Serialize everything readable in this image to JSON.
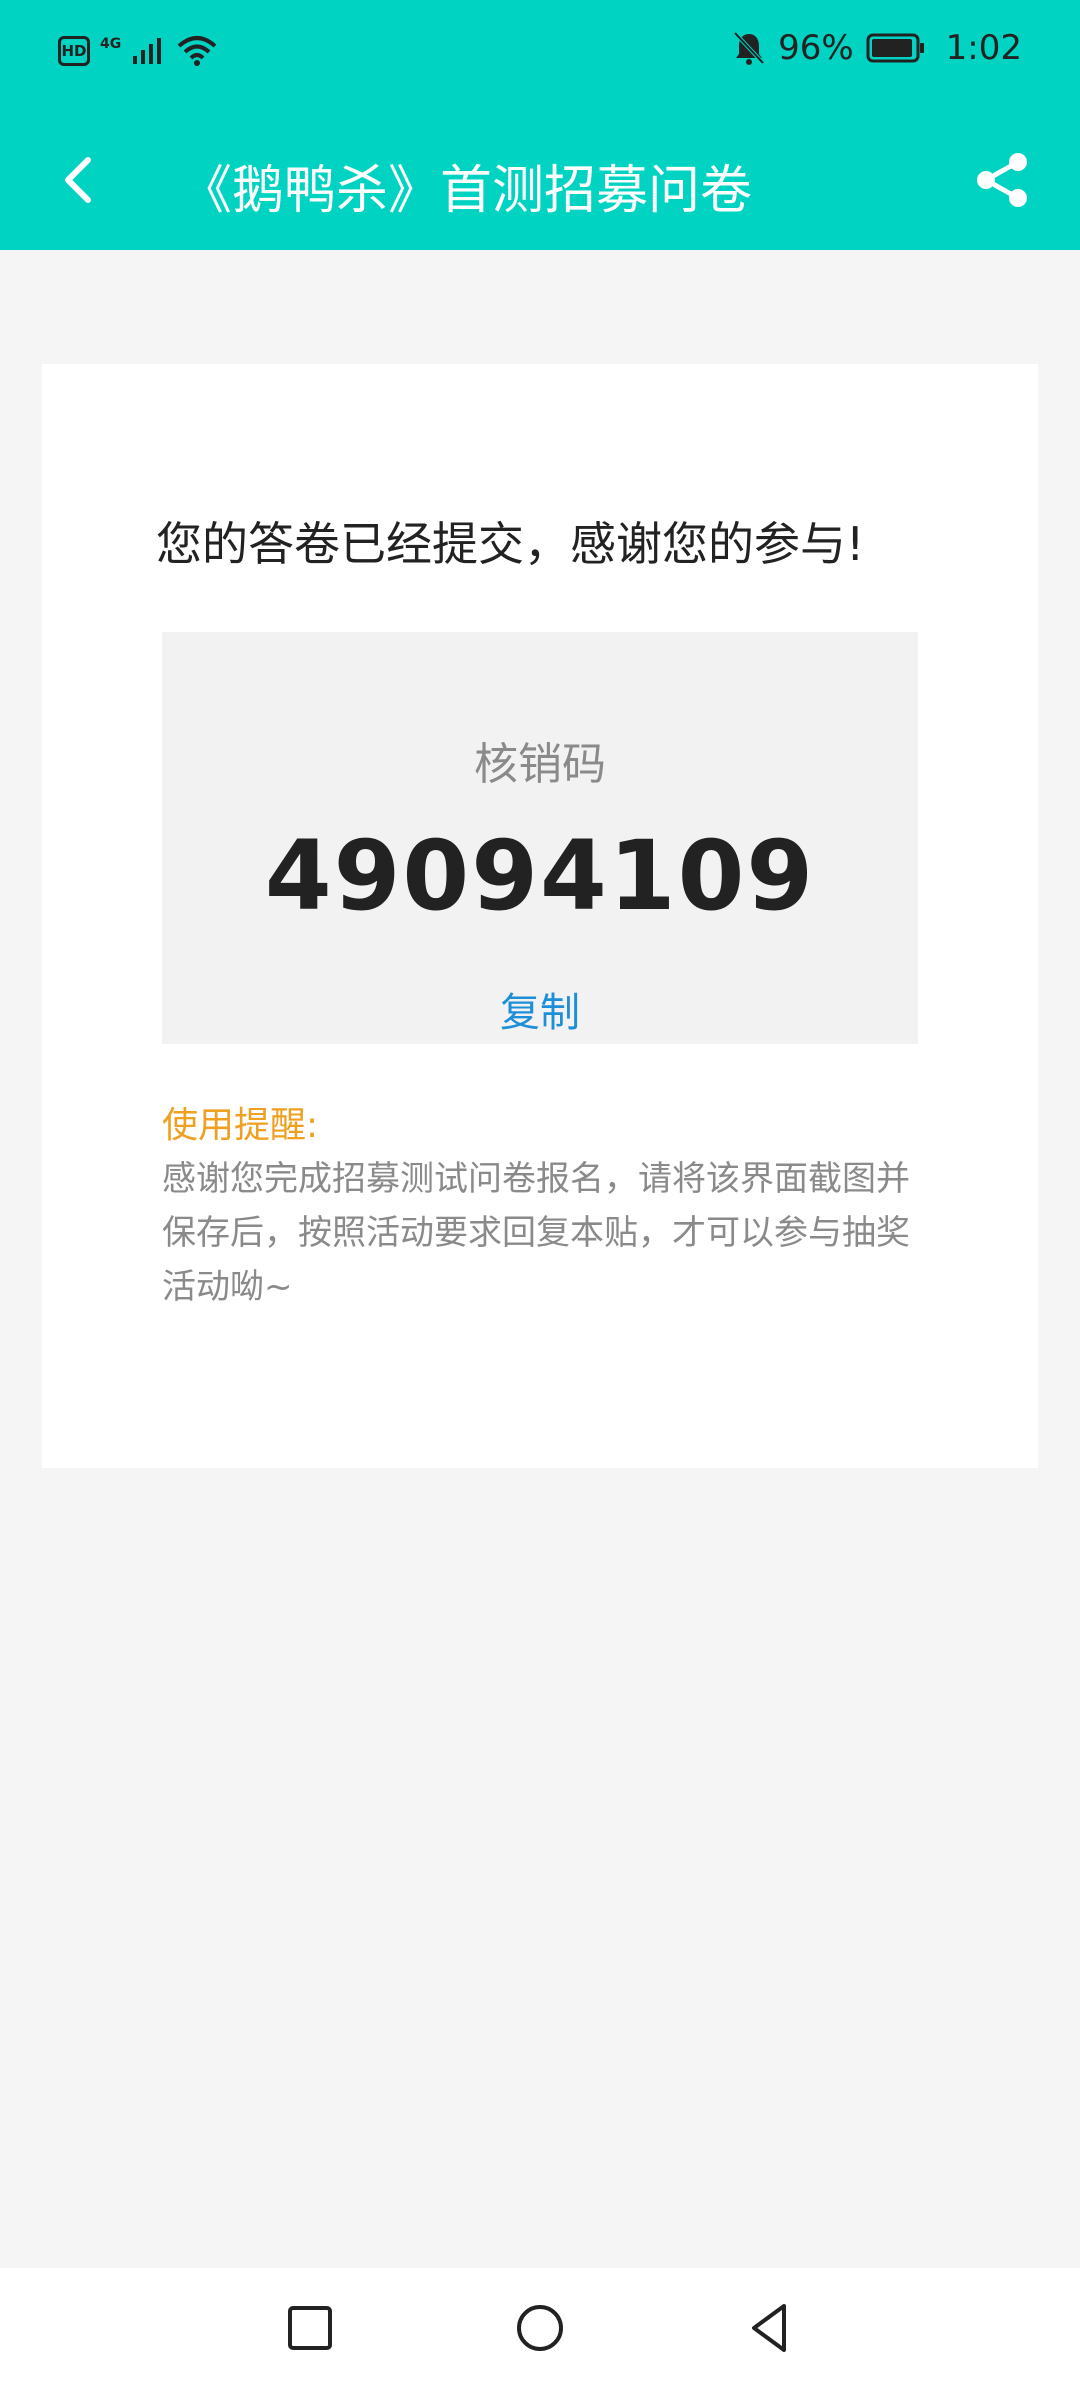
{
  "status_bar": {
    "hd_label": "HD",
    "network_label": "4G",
    "battery_percent": "96%",
    "time": "1:02",
    "battery_level": 0.96
  },
  "app_bar": {
    "title": "《鹅鸭杀》首测招募问卷",
    "back_icon": "chevron-left-icon",
    "share_icon": "share-icon"
  },
  "result": {
    "submitted_message": "您的答卷已经提交，感谢您的参与!",
    "code_label": "核销码",
    "code_value": "49094109",
    "copy_label": "复制",
    "reminder_title": "使用提醒:",
    "reminder_text": "感谢您完成招募测试问卷报名，请将该界面截图并保存后，按照活动要求回复本贴，才可以参与抽奖活动呦~"
  },
  "colors": {
    "accent": "#00d3c1",
    "link": "#1d8fd8",
    "reminder": "#f0a020",
    "background": "#f5f5f5"
  },
  "nav_bar": {
    "icons": [
      "square-icon",
      "circle-home-icon",
      "triangle-back-icon"
    ]
  }
}
